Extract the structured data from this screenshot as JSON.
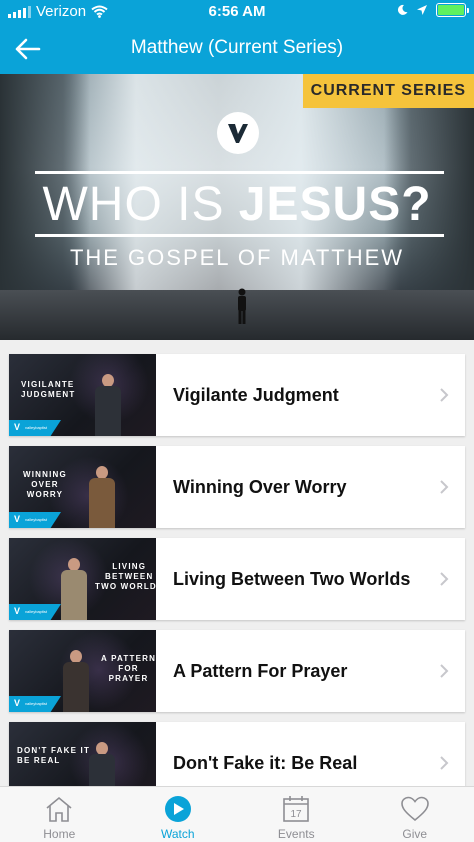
{
  "status_bar": {
    "carrier": "Verizon",
    "time": "6:56 AM"
  },
  "nav": {
    "title": "Matthew (Current Series)"
  },
  "hero": {
    "badge": "CURRENT SERIES",
    "title_light": "WHO IS ",
    "title_bold": "JESUS?",
    "subtitle": "THE GOSPEL OF MATTHEW"
  },
  "sermons": [
    {
      "title": "Vigilante Judgment",
      "thumb_text": "VIGILANTE\nJUDGMENT"
    },
    {
      "title": "Winning Over Worry",
      "thumb_text": "WINNING\nOVER\nWORRY"
    },
    {
      "title": "Living Between Two Worlds",
      "thumb_text": "LIVING\nBETWEEN\nTWO WORLDS"
    },
    {
      "title": "A Pattern For Prayer",
      "thumb_text": "A PATTERN\nFOR\nPRAYER"
    },
    {
      "title": "Don't Fake it: Be Real",
      "thumb_text": "DON'T FAKE IT\nBE REAL"
    }
  ],
  "tabs": [
    {
      "label": "Home",
      "icon": "home-icon",
      "active": false
    },
    {
      "label": "Watch",
      "icon": "play-icon",
      "active": true
    },
    {
      "label": "Events",
      "icon": "calendar-icon",
      "active": false,
      "calendar_day": "17"
    },
    {
      "label": "Give",
      "icon": "heart-icon",
      "active": false
    }
  ],
  "colors": {
    "accent": "#0aa3d8",
    "badge": "#f5c33b",
    "battery": "#5ff15f"
  }
}
